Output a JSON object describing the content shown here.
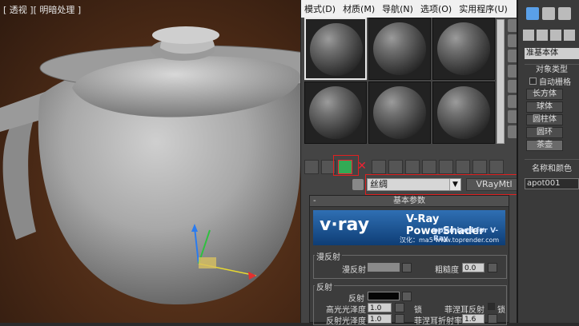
{
  "viewport": {
    "label": "[ 透视 ][ 明暗处理 ]"
  },
  "menubar": {
    "items": [
      "模式(D)",
      "材质(M)",
      "导航(N)",
      "选项(O)",
      "实用程序(U)"
    ]
  },
  "material": {
    "name": "丝绸",
    "type": "VRayMtl",
    "rollout_basic": "基本参数",
    "banner": {
      "logo": "v·ray",
      "title": "V-Ray PowerShader",
      "subtitle": "optimized for V-Ray",
      "footer": "汉化：ma5 www.toprender.com"
    },
    "diffuse_group": "漫反射",
    "diffuse_label": "漫反射",
    "roughness_label": "粗糙度",
    "roughness_value": "0.0",
    "reflect_group": "反射",
    "reflect_label": "反射",
    "hilight_gloss_label": "高光光泽度",
    "hilight_gloss_value": "1.0",
    "lock_label": "锁",
    "fresnel_label": "菲涅耳反射",
    "refl_gloss_label": "反射光泽度",
    "refl_gloss_value": "1.0",
    "fresnel_ior_label": "菲涅耳折射率",
    "fresnel_ior_value": "1.6"
  },
  "command_panel": {
    "dropdown": "准基本体",
    "rollout_object_type": "对象类型",
    "autogrid_label": "自动栅格",
    "buttons": [
      "长方体",
      "球体",
      "圆柱体",
      "圆环",
      "茶壶"
    ],
    "rollout_name": "名称和颜色",
    "object_name": "apot001"
  },
  "colors": {
    "highlight_box": "#e02020",
    "vray_banner": "#1c5aa0"
  }
}
